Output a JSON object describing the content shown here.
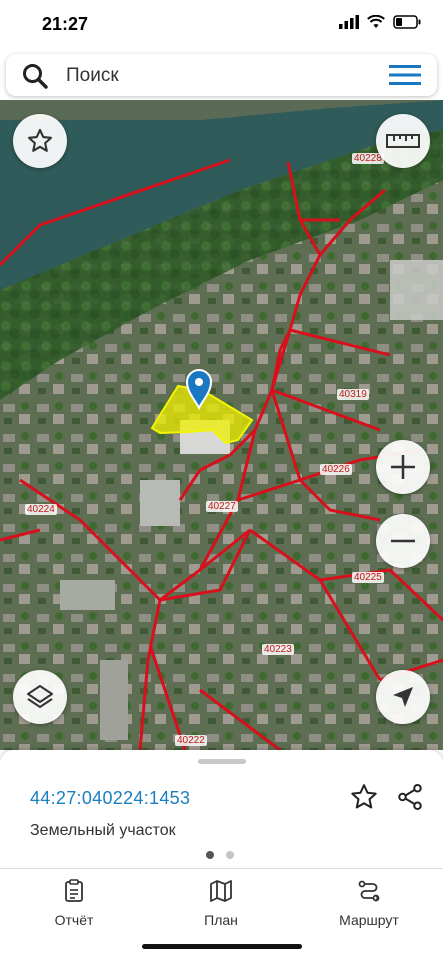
{
  "status_bar": {
    "time": "21:27"
  },
  "search": {
    "placeholder": "Поиск",
    "search_icon": "search-icon",
    "menu_icon": "hamburger-menu-icon"
  },
  "map": {
    "block_labels": [
      "40228",
      "40319",
      "40226",
      "40224",
      "40227",
      "40225",
      "40223",
      "40222"
    ],
    "buttons": {
      "favorite": "star-icon",
      "ruler": "ruler-icon",
      "zoom_in": "plus-icon",
      "zoom_out": "minus-icon",
      "layers": "layers-icon",
      "locate": "navigation-arrow-icon"
    },
    "parcel_color": "#f0f000",
    "boundary_color": "#d8101c",
    "marker_color": "#1a78c2"
  },
  "sheet": {
    "cadastral_number": "44:27:040224:1453",
    "property_type": "Земельный участок",
    "page_count": 2,
    "active_page": 1
  },
  "tabs": [
    {
      "label": "Отчёт",
      "icon": "report-icon"
    },
    {
      "label": "План",
      "icon": "map-icon"
    },
    {
      "label": "Маршрут",
      "icon": "route-icon"
    }
  ]
}
